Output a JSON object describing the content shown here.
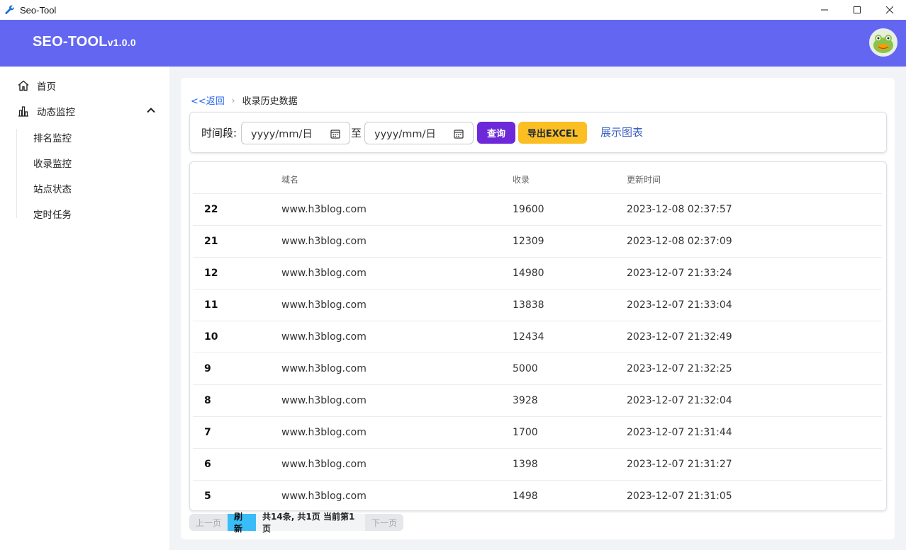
{
  "window": {
    "title": "Seo-Tool"
  },
  "header": {
    "brand": "SEO-TOOL",
    "version": "v1.0.0"
  },
  "sidebar": {
    "home": "首页",
    "monitor": "动态监控",
    "sub": [
      "排名监控",
      "收录监控",
      "站点状态",
      "定时任务"
    ]
  },
  "breadcrumb": {
    "back": "<<返回",
    "current": "收录历史数据"
  },
  "filter": {
    "label": "时间段:",
    "to": "至",
    "start_placeholder": "yyyy/mm/日",
    "end_placeholder": "yyyy/mm/日",
    "query": "查询",
    "export": "导出EXCEL",
    "chart": "展示图表"
  },
  "table": {
    "headers": [
      "域名",
      "收录",
      "更新时间"
    ],
    "rows": [
      {
        "id": "22",
        "domain": "www.h3blog.com",
        "count": "19600",
        "time": "2023-12-08 02:37:57"
      },
      {
        "id": "21",
        "domain": "www.h3blog.com",
        "count": "12309",
        "time": "2023-12-08 02:37:09"
      },
      {
        "id": "12",
        "domain": "www.h3blog.com",
        "count": "14980",
        "time": "2023-12-07 21:33:24"
      },
      {
        "id": "11",
        "domain": "www.h3blog.com",
        "count": "13838",
        "time": "2023-12-07 21:33:04"
      },
      {
        "id": "10",
        "domain": "www.h3blog.com",
        "count": "12434",
        "time": "2023-12-07 21:32:49"
      },
      {
        "id": "9",
        "domain": "www.h3blog.com",
        "count": "5000",
        "time": "2023-12-07 21:32:25"
      },
      {
        "id": "8",
        "domain": "www.h3blog.com",
        "count": "3928",
        "time": "2023-12-07 21:32:04"
      },
      {
        "id": "7",
        "domain": "www.h3blog.com",
        "count": "1700",
        "time": "2023-12-07 21:31:44"
      },
      {
        "id": "6",
        "domain": "www.h3blog.com",
        "count": "1398",
        "time": "2023-12-07 21:31:27"
      },
      {
        "id": "5",
        "domain": "www.h3blog.com",
        "count": "1498",
        "time": "2023-12-07 21:31:05"
      }
    ]
  },
  "pager": {
    "prev": "上一页",
    "refresh": "刷新",
    "info": "共14条, 共1页 当前第1页",
    "next": "下一页"
  },
  "colors": {
    "header": "#6366f1",
    "query": "#6d28d9",
    "export": "#fbbf24",
    "refresh": "#38bdf8"
  }
}
